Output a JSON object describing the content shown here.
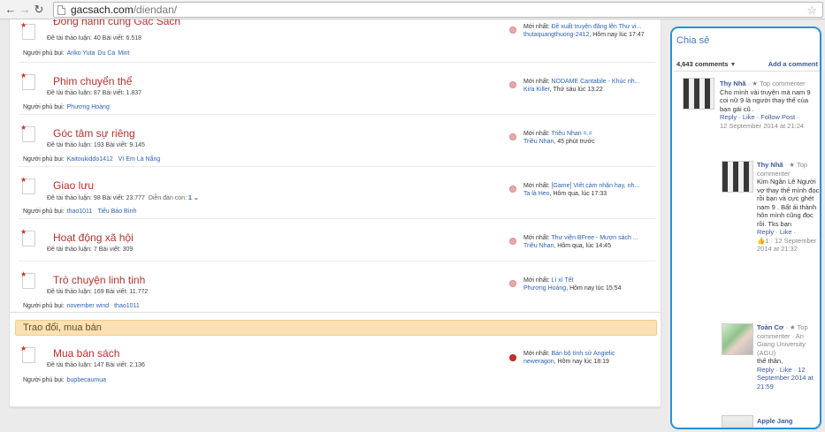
{
  "browser": {
    "url_host": "gacsach.com",
    "url_path": "/diendan/",
    "back_icon": "arrow-left-icon",
    "forward_icon": "arrow-right-icon",
    "reload_icon": "reload-icon",
    "bookmark_icon": "star-icon"
  },
  "forums": [
    {
      "title": "Đồng hành cùng Gác Sách",
      "stats": "Đề tài thảo luận: 40 Bài viết: 6.518",
      "mods_label": "Người phủ bụi:",
      "mods": [
        "Ariko Yuta",
        "Du Ca",
        "Mint"
      ],
      "last_label": "Mới nhất:",
      "last_title": "Đề xuất truyện đăng lên Thư vi...",
      "last_user": "thutaquangthuong-2412",
      "last_time": ", Hôm nay lúc 17:47"
    },
    {
      "title": "Phim chuyển thể",
      "stats": "Đề tài thảo luận: 87 Bài viết: 1.837",
      "mods_label": "Người phủ bụi:",
      "mods": [
        "Phương Hoàng"
      ],
      "last_label": "Mới nhất:",
      "last_title": "NODAME Cantabile - Khúc nh...",
      "last_user": "Kira Killer",
      "last_time": ", Thứ sáu lúc 13:22"
    },
    {
      "title": "Góc tâm sự riêng",
      "stats": "Đề tài thảo luận: 193 Bài viết: 9.145",
      "mods_label": "Người phủ bụi:",
      "mods": [
        "Kaitoukiddo1412",
        "Vì Em Là Nắng"
      ],
      "last_label": "Mới nhất:",
      "last_title": "Triều Nhan =.=",
      "last_user": "Triều Nhan",
      "last_time": ", 45 phút trước"
    },
    {
      "title": "Giao lưu",
      "stats": "Đề tài thảo luận: 98 Bài viết: 23.777",
      "sub_label": "Diễn đàn con:",
      "sub_count": "1",
      "mods_label": "Người phủ bụi:",
      "mods": [
        "thao1011",
        "Tiểu Bảo Bình"
      ],
      "last_label": "Mới nhất:",
      "last_title": "[Game] Viết cảm nhận hay, nh...",
      "last_user": "Ta là Heo",
      "last_time": ", Hôm qua, lúc 17:33"
    },
    {
      "title": "Hoạt động xã hội",
      "stats": "Đề tài thảo luận: 7 Bài viết: 309",
      "last_label": "Mới nhất:",
      "last_title": "Thư viện BFree - Mượn sách ...",
      "last_user": "Triều Nhan",
      "last_time": ", Hôm qua, lúc 14:45"
    },
    {
      "title": "Trò chuyện linh tinh",
      "stats": "Đề tài thảo luận: 169 Bài viết: 11.772",
      "mods_label": "Người phủ bụi:",
      "mods": [
        "november wind",
        "thao1011"
      ],
      "last_label": "Mới nhất:",
      "last_title": "Lì xì Tết",
      "last_user": "Phương Hoàng",
      "last_time": ", Hôm nay lúc 15:54"
    }
  ],
  "category2": {
    "title": "Trao đổi, mua bán",
    "forum": {
      "title": "Mua bán sách",
      "stats": "Đề tài thảo luận: 147 Bài viết: 2.136",
      "mods_label": "Người phủ bụi:",
      "mods": [
        "bupbecaumua"
      ],
      "last_label": "Mới nhất:",
      "last_title": "Bán bộ tình sử Angielic",
      "last_user": "neweragon",
      "last_time": ", Hôm nay lúc 18:19"
    }
  },
  "sidebar": {
    "title": "Chia sẻ",
    "count": "4,643 comments",
    "add_label": "Add a comment",
    "comments": [
      {
        "name": "Thy Nhã",
        "badge": "· ★ Top commenter",
        "text": "Cho mình vài truyện mà nam 9 coi nữ 9 là người thay thế của bạn gái cũ .",
        "actions": "Reply · Like · Follow Post ·",
        "date": "12 September 2014 at 21:24"
      },
      {
        "name": "Thy Nhã",
        "badge": "· ★ Top commenter",
        "text": "Kim Ngân Lê Người vợ thay thế mình đọc rồi bạn và cực ghét nam 9 . Bất ái thành hôn mình cũng đọc rồi. Tks bạn",
        "actions": "Reply · Like ·",
        "likes": "1 · 12 September 2014 at 21:32"
      },
      {
        "name": "Toàn Cơ",
        "badge": "· ★ Top commenter · An Giang University (AGU)",
        "text": "thế thân,",
        "actions": "Reply · Like · 12 September 2014 at 21:59"
      },
      {
        "name": "Apple Jang"
      }
    ]
  },
  "colors": {
    "forum_title": "#b4312e",
    "link": "#2d63b4",
    "sidebar_border": "#2a8fd6",
    "category_bar": "#fbe1b4"
  }
}
